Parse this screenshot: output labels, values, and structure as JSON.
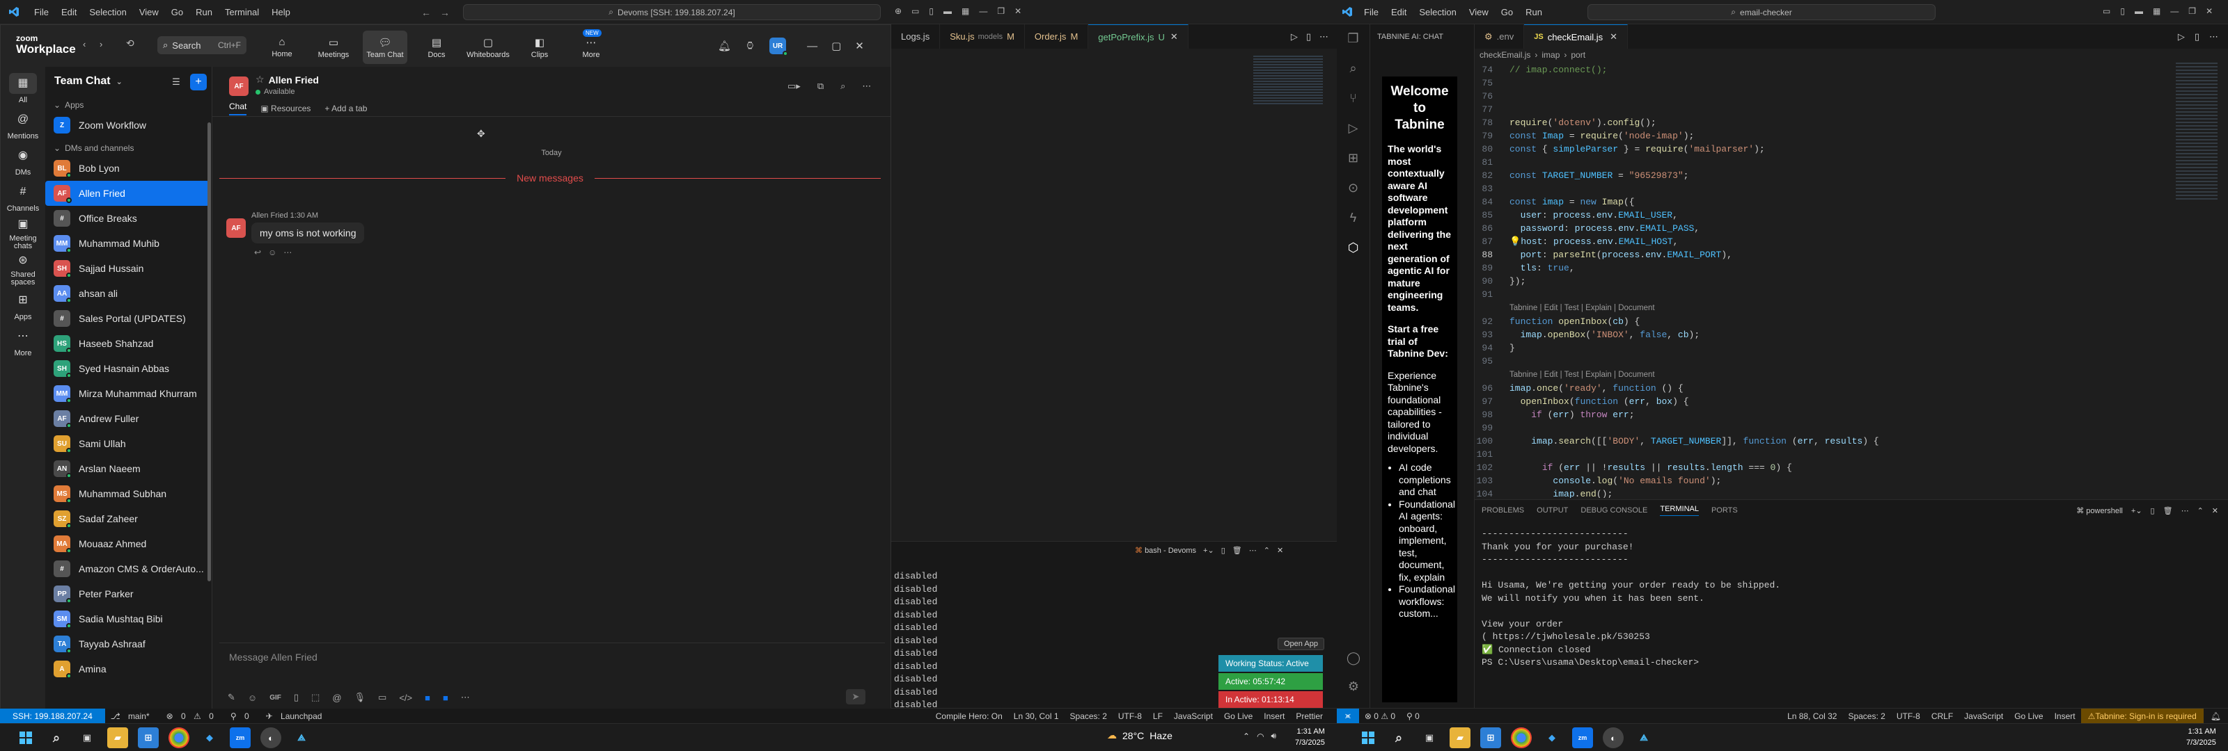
{
  "vs_left": {
    "menu": [
      "File",
      "Edit",
      "Selection",
      "View",
      "Go",
      "Run",
      "Terminal",
      "Help"
    ],
    "command_center": "Devoms [SSH: 199.188.207.24]",
    "tabs": [
      {
        "label": "Logs.js",
        "mod": ""
      },
      {
        "label": "Sku.js",
        "sub": "models",
        "mod": "M"
      },
      {
        "label": "Order.js",
        "mod": "M"
      },
      {
        "label": "getPoPrefix.js",
        "mod": "U"
      }
    ],
    "terminal_title": "bash - Devoms",
    "terminal_lines": [
      "disabled",
      "disabled",
      "disabled",
      "disabled",
      "disabled",
      "disabled",
      "disabled",
      "disabled",
      "disabled",
      "disabled",
      "disabled",
      "disabled"
    ],
    "status": {
      "remote": "SSH: 199.188.207.24",
      "branch": "main*",
      "errors": "0",
      "warnings": "0",
      "ports": "0",
      "launchpad": "Launchpad",
      "compile_hero": "Compile Hero: On",
      "position": "Ln 30, Col 1",
      "spaces": "Spaces: 2",
      "encoding": "UTF-8",
      "eol": "LF",
      "language": "JavaScript",
      "golive": "Go Live",
      "insert": "Insert",
      "prettier": "Prettier"
    },
    "open_app": "Open App",
    "working_status": "Working Status: Active",
    "active_time": "Active: 05:57:42",
    "inactive_time": "In Active: 01:13:14"
  },
  "zoom": {
    "logo_top": "zoom",
    "logo_bottom": "Workplace",
    "search_label": "Search",
    "search_kbd": "Ctrl+F",
    "nav": [
      {
        "label": "Home",
        "icon": "home-icon"
      },
      {
        "label": "Meetings",
        "icon": "meetings-icon"
      },
      {
        "label": "Team Chat",
        "icon": "team-chat-icon",
        "active": true
      },
      {
        "label": "Docs",
        "icon": "docs-icon"
      },
      {
        "label": "Whiteboards",
        "icon": "whiteboard-icon"
      },
      {
        "label": "Clips",
        "icon": "clips-icon"
      },
      {
        "label": "More",
        "icon": "more-icon",
        "badge": "NEW"
      }
    ],
    "avatar_initials": "UR",
    "rail": [
      {
        "label": "All",
        "active": true
      },
      {
        "label": "Mentions"
      },
      {
        "label": "DMs"
      },
      {
        "label": "Channels"
      },
      {
        "label": "Meeting chats"
      },
      {
        "label": "Shared spaces"
      },
      {
        "label": "Apps"
      },
      {
        "label": "More"
      }
    ],
    "sidebar_title": "Team Chat",
    "section_apps": "Apps",
    "section_dms": "DMs and channels",
    "apps": [
      {
        "name": "Zoom Workflow",
        "initials": "Z",
        "color": "#0e71eb"
      }
    ],
    "contacts": [
      {
        "name": "Bob Lyon",
        "initials": "BL",
        "color": "#e07b39"
      },
      {
        "name": "Allen Fried",
        "initials": "AF",
        "color": "#d9534f",
        "active": true
      },
      {
        "name": "Office Breaks",
        "initials": "#",
        "color": "#555555"
      },
      {
        "name": "Muhammad Muhib",
        "initials": "MM",
        "color": "#5b8def"
      },
      {
        "name": "Sajjad Hussain",
        "initials": "SH",
        "color": "#d9534f"
      },
      {
        "name": "ahsan ali",
        "initials": "AA",
        "color": "#5b8def"
      },
      {
        "name": "Sales Portal (UPDATES)",
        "initials": "#",
        "color": "#555555"
      },
      {
        "name": "Haseeb Shahzad",
        "initials": "HS",
        "color": "#2ea27a"
      },
      {
        "name": "Syed Hasnain Abbas",
        "initials": "SH",
        "color": "#2ea27a"
      },
      {
        "name": "Mirza Muhammad Khurram",
        "initials": "MM",
        "color": "#5b8def"
      },
      {
        "name": "Andrew Fuller",
        "initials": "AF",
        "color": "#6b7fa3"
      },
      {
        "name": "Sami Ullah",
        "initials": "SU",
        "color": "#e0a030"
      },
      {
        "name": "Arslan Naeem",
        "initials": "AN",
        "color": "#4a4a4a"
      },
      {
        "name": "Muhammad Subhan",
        "initials": "MS",
        "color": "#e07b39"
      },
      {
        "name": "Sadaf Zaheer",
        "initials": "SZ",
        "color": "#e0a030"
      },
      {
        "name": "Mouaaz Ahmed",
        "initials": "MA",
        "color": "#e07b39"
      },
      {
        "name": "Amazon CMS & OrderAuto...",
        "initials": "#",
        "color": "#555555"
      },
      {
        "name": "Peter Parker",
        "initials": "PP",
        "color": "#6b7fa3"
      },
      {
        "name": "Sadia Mushtaq Bibi",
        "initials": "SM",
        "color": "#5b8def"
      },
      {
        "name": "Tayyab Ashraaf",
        "initials": "TA",
        "color": "#2d7fd6"
      },
      {
        "name": "Amina",
        "initials": "A",
        "color": "#e0a030"
      }
    ],
    "chat": {
      "contact_name": "Allen Fried",
      "contact_initials": "AF",
      "contact_status": "Available",
      "tabs": [
        "Chat",
        "Resources",
        "Add a tab"
      ],
      "date_divider": "Today",
      "new_messages": "New messages",
      "msg_sender": "Allen Fried",
      "msg_time": "1:30 AM",
      "msg_text": "my oms is not working",
      "composer_placeholder": "Message Allen Fried"
    }
  },
  "vs_right": {
    "menu": [
      "File",
      "Edit",
      "Selection",
      "View",
      "Go",
      "Run"
    ],
    "search": "email-checker",
    "tabnine_header": "TABNINE AI: CHAT",
    "tabs": [
      {
        "label": ".env"
      },
      {
        "label": "checkEmail.js",
        "active": true
      }
    ],
    "breadcrumb": [
      "checkEmail.js",
      "imap",
      "port"
    ],
    "tabnine_panel": {
      "title": "Welcome to Tabnine",
      "p1": "The world's most contextually aware AI software development platform delivering the next generation of agentic AI for mature engineering teams.",
      "p2": "Start a free trial of Tabnine Dev:",
      "p3": "Experience Tabnine's foundational capabilities - tailored to individual developers.",
      "bullets": [
        "AI code completions and chat",
        "Foundational AI agents: onboard, implement, test, document, fix, explain",
        "Foundational workflows: custom..."
      ]
    },
    "code_lens": "Tabnine | Edit | Test | Explain | Document",
    "panel_tabs": [
      "PROBLEMS",
      "OUTPUT",
      "DEBUG CONSOLE",
      "TERMINAL",
      "PORTS"
    ],
    "terminal_shell": "powershell",
    "terminal_lines": [
      "---------------------------",
      "Thank you for your purchase!",
      "---------------------------",
      "",
      "Hi Usama, We're getting your order ready to be shipped.",
      "We will notify you when it has been sent.",
      "",
      "View your order",
      "( https://tjwholesale.pk/530253",
      "✅ Connection closed",
      "PS C:\\Users\\usama\\Desktop\\email-checker> "
    ],
    "status": {
      "errors": "0",
      "warnings": "0",
      "ports": "0",
      "position": "Ln 88, Col 32",
      "spaces": "Spaces: 2",
      "encoding": "UTF-8",
      "eol": "CRLF",
      "language": "JavaScript",
      "golive": "Go Live",
      "insert": "Insert",
      "tabnine": "Tabnine: Sign-in is required"
    }
  },
  "taskbar": {
    "weather_temp": "28°C",
    "weather_desc": "Haze",
    "time_left": "1:31 AM",
    "date_left": "7/3/2025",
    "time_right": "1:31 AM",
    "date_right": "7/3/2025"
  }
}
